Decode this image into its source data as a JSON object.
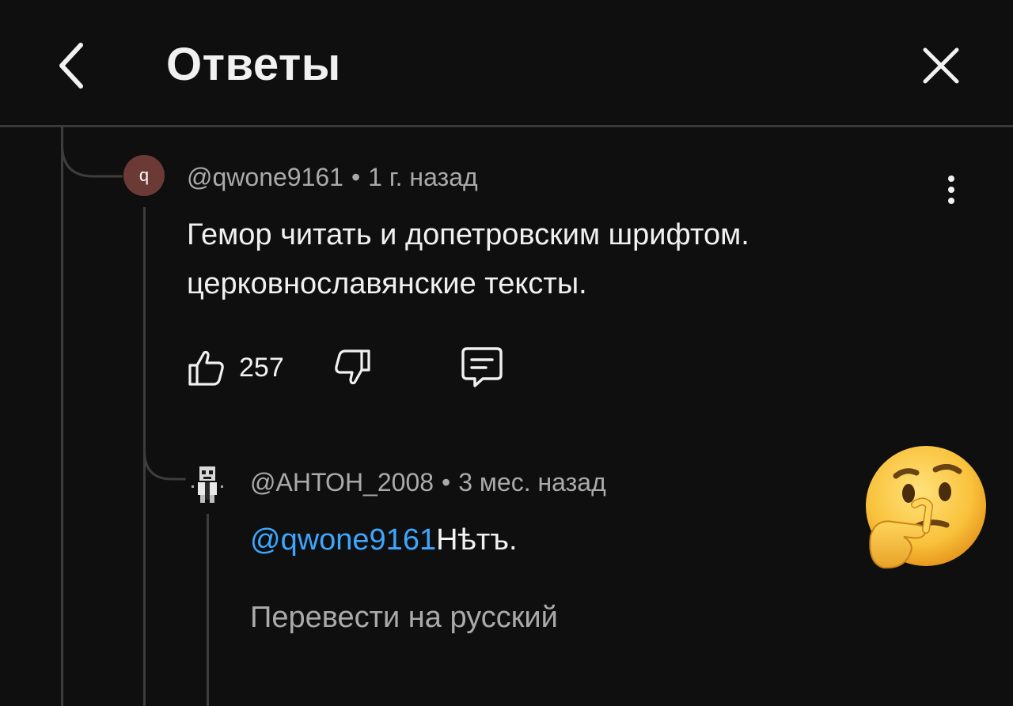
{
  "header": {
    "title": "Ответы",
    "back_icon": "chevron-left-icon",
    "close_icon": "close-icon"
  },
  "comment": {
    "avatar_letter": "q",
    "author": "@qwone9161",
    "separator": "•",
    "time": "1 г. назад",
    "text_line1": "Гемор читать и допетровским шрифтом.",
    "text_line2": "церковнославянские тексты.",
    "likes": "257",
    "icons": [
      "thumb-up-icon",
      "thumb-down-icon",
      "reply-icon",
      "more-vert-icon"
    ]
  },
  "reply": {
    "author": "@АНТОН_2008",
    "separator": "•",
    "time": "3 мес. назад",
    "mention": "@qwone9161",
    "text": "Нѣтъ.",
    "translate": "Перевести на русский"
  },
  "overlay": {
    "emoji": "thinking-face-emoji"
  },
  "colors": {
    "background": "#0f0f0f",
    "text": "#f1f1f1",
    "secondary_text": "#aaaaaa",
    "mention": "#3ea6ff",
    "thread_line": "#3d3d3d",
    "avatar_q": "#6b3a35"
  }
}
